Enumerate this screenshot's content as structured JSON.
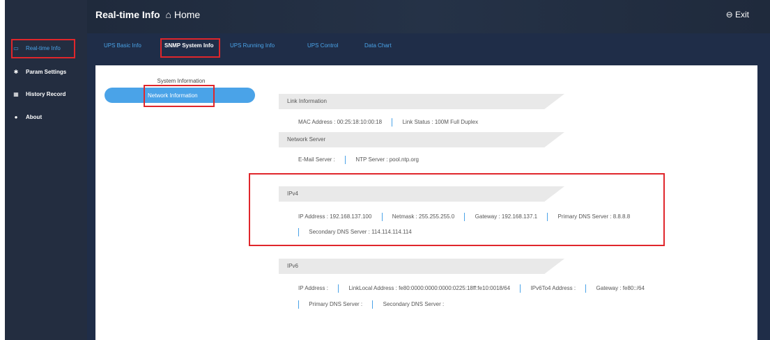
{
  "header": {
    "title": "Real-time Info",
    "home_label": "Home",
    "exit_label": "Exit"
  },
  "sidebar": {
    "items": [
      {
        "label": "Real-time Info"
      },
      {
        "label": "Param Settings"
      },
      {
        "label": "History Record"
      },
      {
        "label": "About"
      }
    ]
  },
  "tabs": [
    {
      "label": "UPS Basic Info"
    },
    {
      "label": "SNMP System Info"
    },
    {
      "label": "UPS Running Info"
    },
    {
      "label": "UPS Control"
    },
    {
      "label": "Data Chart"
    }
  ],
  "subnav": {
    "system_info": "System Information",
    "network_info": "Network Information"
  },
  "link": {
    "heading": "Link Information",
    "mac_label": "MAC Address :",
    "mac_value": "00:25:18:10:00:18",
    "status_label": "Link Status :",
    "status_value": "100M Full Duplex"
  },
  "server": {
    "heading": "Network Server",
    "email_label": "E-Mail Server :",
    "ntp_label": "NTP Server :",
    "ntp_value": "pool.ntp.org"
  },
  "ipv4": {
    "heading": "IPv4",
    "ip_label": "IP Address :",
    "ip_value": "192.168.137.100",
    "netmask_label": "Netmask :",
    "netmask_value": "255.255.255.0",
    "gateway_label": "Gateway :",
    "gateway_value": "192.168.137.1",
    "dns1_label": "Primary DNS Server :",
    "dns1_value": "8.8.8.8",
    "dns2_label": "Secondary DNS Server :",
    "dns2_value": "114.114.114.114"
  },
  "ipv6": {
    "heading": "IPv6",
    "ip_label": "IP Address :",
    "linklocal_label": "LinkLocal Address :",
    "linklocal_value": "fe80:0000:0000:0000:0225:18ff:fe10:0018/64",
    "6to4_label": "IPv6To4 Address :",
    "gateway_label": "Gateway :",
    "gateway_value": "fe80::/64",
    "dns1_label": "Primary DNS Server :",
    "dns2_label": "Secondary DNS Server :"
  },
  "colors": {
    "accent": "#4aa3e8",
    "highlight": "#e0262b",
    "sidebar": "#232d40"
  }
}
